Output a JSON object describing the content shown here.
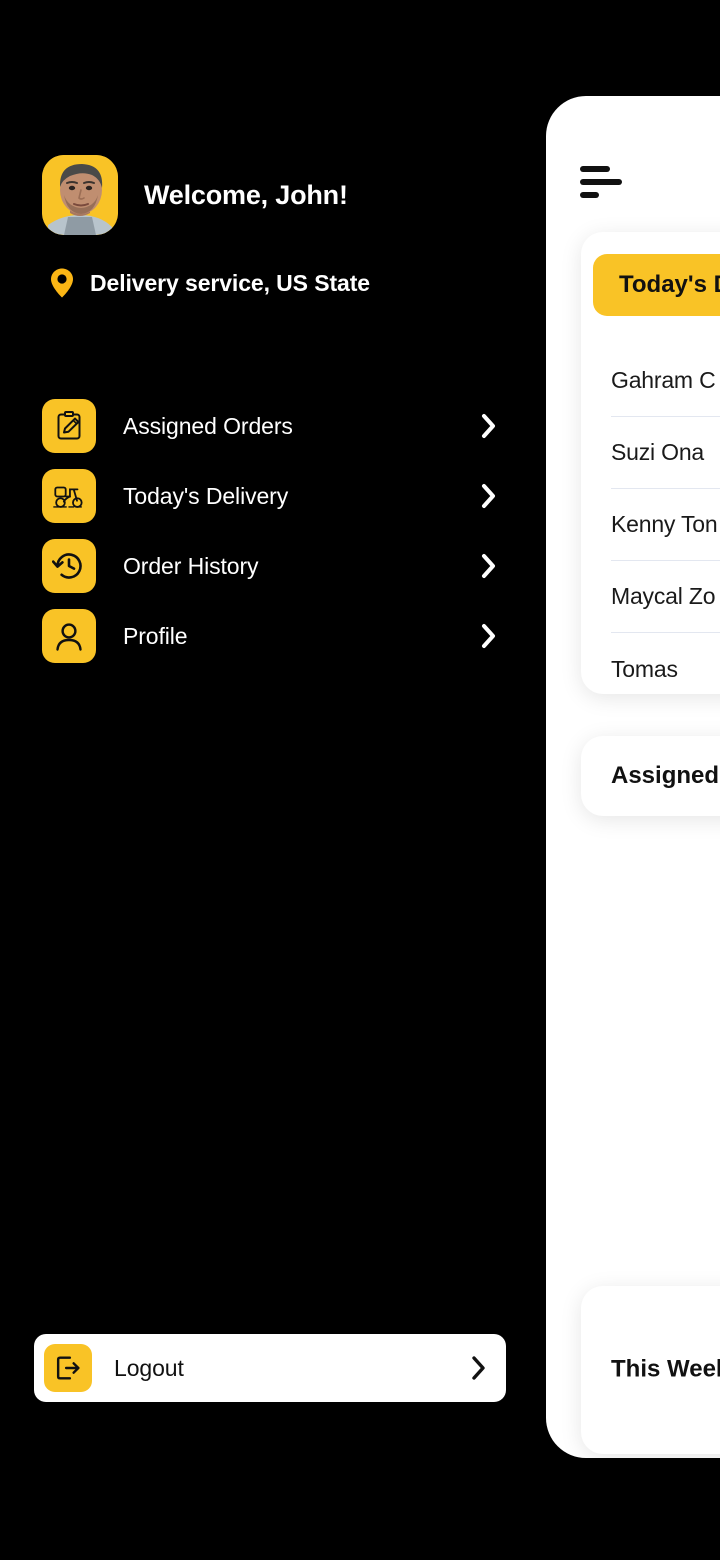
{
  "theme": {
    "accent": "#F9C326",
    "background": "#000000",
    "panel": "#ffffff",
    "text_on_dark": "#ffffff",
    "text_on_light": "#111111",
    "divider": "#E3E7F0"
  },
  "drawer": {
    "avatar_icon": "user-photo-avatar",
    "welcome": "Welcome, John!",
    "location_icon": "map-pin-icon",
    "location": "Delivery service, US State",
    "items": [
      {
        "icon": "clipboard-pencil-icon",
        "label": "Assigned Orders",
        "chevron": "chevron-right-icon"
      },
      {
        "icon": "scooter-delivery-icon",
        "label": "Today's Delivery",
        "chevron": "chevron-right-icon"
      },
      {
        "icon": "clock-history-icon",
        "label": "Order History",
        "chevron": "chevron-right-icon"
      },
      {
        "icon": "person-icon",
        "label": "Profile",
        "chevron": "chevron-right-icon"
      }
    ],
    "logout": {
      "icon": "logout-arrow-icon",
      "label": "Logout",
      "chevron": "chevron-right-icon"
    }
  },
  "main": {
    "menu_icon": "hamburger-menu-icon",
    "today_card": {
      "title": "Today's D",
      "rows": [
        {
          "name": "Gahram C"
        },
        {
          "name": "Suzi Ona"
        },
        {
          "name": "Kenny Ton"
        },
        {
          "name": "Maycal Zo"
        },
        {
          "name": "Tomas"
        }
      ]
    },
    "assigned_card": {
      "title": "Assigned"
    },
    "week_card": {
      "title": "This Week\nDeliveries"
    }
  }
}
